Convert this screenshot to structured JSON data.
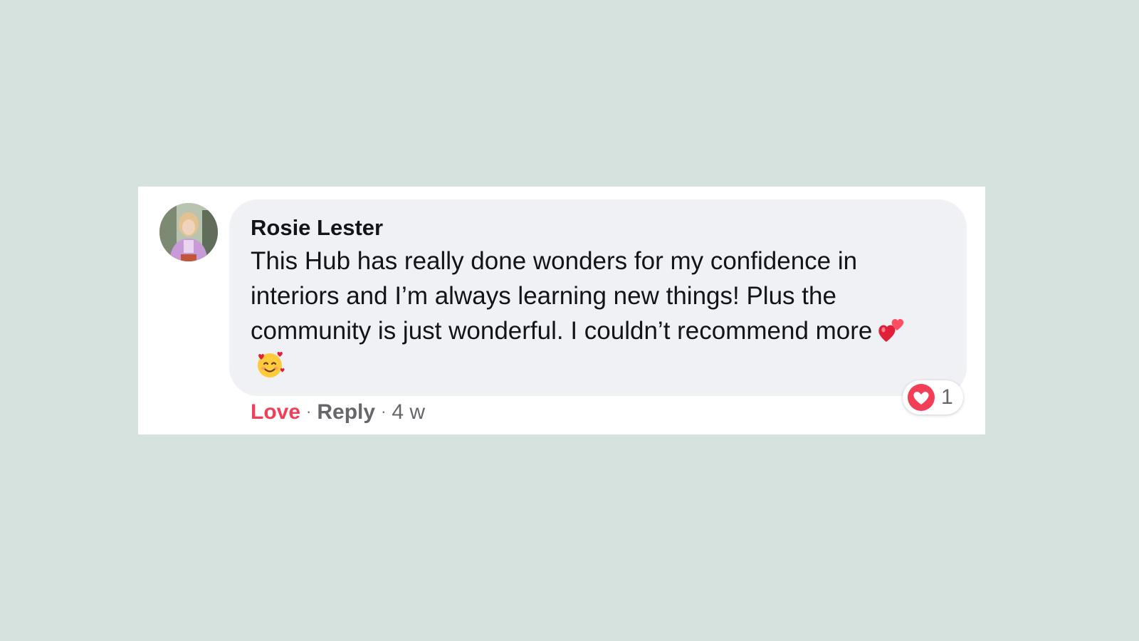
{
  "comment": {
    "author": "Rosie Lester",
    "text": "This Hub has really done wonders for my confidence in interiors and I’m always learning new things! Plus the community is just wonderful. I couldn’t recommend more",
    "emojis": [
      "two-hearts-icon",
      "smiling-face-with-hearts-icon"
    ],
    "avatar_icon": "avatar-photo"
  },
  "actions": {
    "love_label": "Love",
    "separator": "·",
    "reply_label": "Reply",
    "timestamp": "4 w"
  },
  "reactions": {
    "icon": "heart-reaction-icon",
    "count": "1"
  },
  "colors": {
    "background": "#d5e2de",
    "card": "#ffffff",
    "bubble": "#eff1f4",
    "love_accent": "#f33e58",
    "muted_text": "#65676b"
  }
}
